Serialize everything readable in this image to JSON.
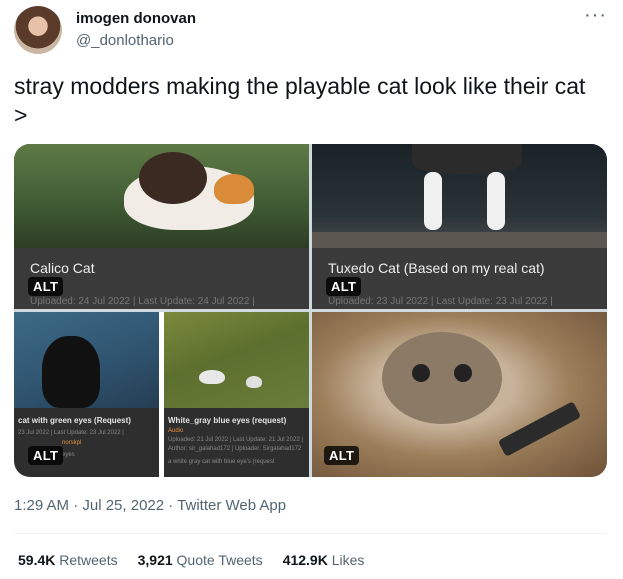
{
  "user": {
    "name": "imogen donovan",
    "handle": "@_donlothario"
  },
  "more_icon": "more-icon",
  "tweet": {
    "text": "stray modders making the playable cat look like their cat >"
  },
  "media": {
    "alt_label": "ALT",
    "tile1": {
      "title": "Calico Cat",
      "meta": "Uploaded: 24 Jul 2022  | Last Update: 24 Jul 2022 |"
    },
    "tile2": {
      "title": "Tuxedo Cat (Based on my real cat)",
      "meta": "Uploaded: 23 Jul 2022  | Last Update: 23 Jul 2022 |"
    },
    "tile3": {
      "left_title": "cat with green eyes (Request)",
      "left_meta": "23 Jul 2022  | Last Update: 23 Jul 2022 |",
      "left_author": "norskpl",
      "left_desc": "eyes",
      "right_title": "White_gray blue eyes (request)",
      "right_cat": "Audio",
      "right_meta": "Uploaded: 21 Jul 2022  | Last Update: 21 Jul 2022 |",
      "right_author": "Author: sir_galahad172 | Uploader: Sirgalahad172",
      "right_desc": "a white gray cat with blue eye's (request"
    }
  },
  "footer": {
    "time": "1:29 AM · Jul 25, 2022 · Twitter Web App",
    "retweets_count": "59.4K",
    "retweets_label": "Retweets",
    "quotes_count": "3,921",
    "quotes_label": "Quote Tweets",
    "likes_count": "412.9K",
    "likes_label": "Likes"
  }
}
